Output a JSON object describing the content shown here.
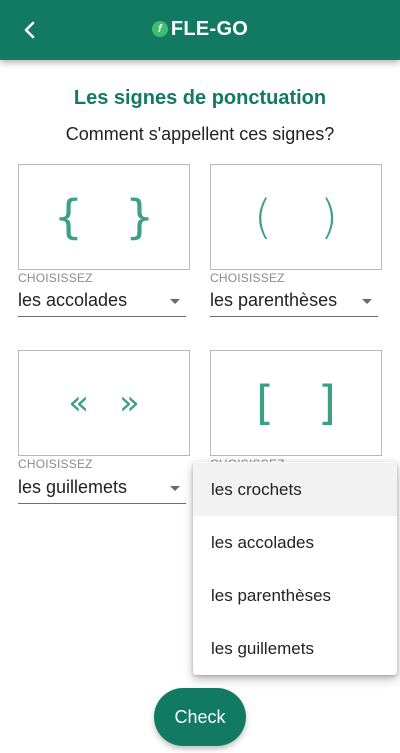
{
  "app": {
    "logo_mark": "f",
    "logo_text": "FLE-GO",
    "brand_color": "#127a63"
  },
  "header": {
    "back_icon": "back-arrow-icon"
  },
  "page": {
    "title": "Les signes de ponctuation",
    "question": "Comment s'appellent ces signes?"
  },
  "questions": [
    {
      "symbol": "{}",
      "select_label": "CHOISISSEZ",
      "selected": "les accolades"
    },
    {
      "symbol": "()",
      "select_label": "CHOISISSEZ",
      "selected": "les parenthèses"
    },
    {
      "symbol": "«»",
      "select_label": "CHOISISSEZ",
      "selected": "les guillemets"
    },
    {
      "symbol": "[]",
      "select_label": "CHOISISSEZ",
      "selected": ""
    }
  ],
  "dropdown": {
    "options": [
      "les crochets",
      "les accolades",
      "les parenthèses",
      "les guillemets"
    ],
    "highlighted": "les crochets"
  },
  "actions": {
    "check_label": "Check"
  }
}
